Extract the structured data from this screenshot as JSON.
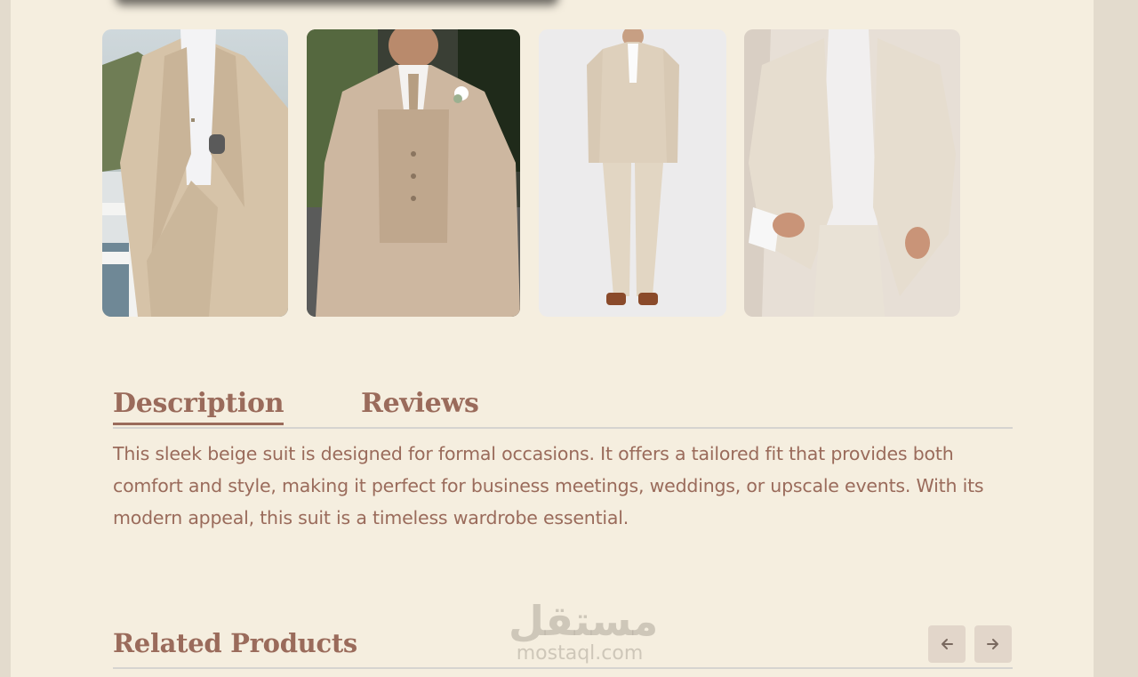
{
  "gallery": {
    "images": [
      {
        "alt": "Beige two-piece suit, man by a white fence"
      },
      {
        "alt": "Beige three-piece suit with boutonniere"
      },
      {
        "alt": "Full-length beige suit on white background"
      },
      {
        "alt": "Light beige linen jacket with white shirt"
      }
    ]
  },
  "tabs": {
    "description": "Description",
    "reviews": "Reviews",
    "active": "description"
  },
  "description": {
    "text": "This sleek beige suit is designed for formal occasions. It offers a tailored fit that provides both comfort and style, making it perfect for business meetings, weddings, or upscale events. With its modern appeal, this suit is a timeless wardrobe essential."
  },
  "related": {
    "title": "Related Products",
    "prev_icon": "arrow-left-icon",
    "next_icon": "arrow-right-icon"
  },
  "watermark": {
    "arabic": "مستقل",
    "latin": "mostaql.com"
  },
  "colors": {
    "background": "#f5eedf",
    "outer": "#e3dbcd",
    "accent": "#9a6b5b",
    "nav_button": "#e2d6ca",
    "divider": "#d6d4d0"
  }
}
